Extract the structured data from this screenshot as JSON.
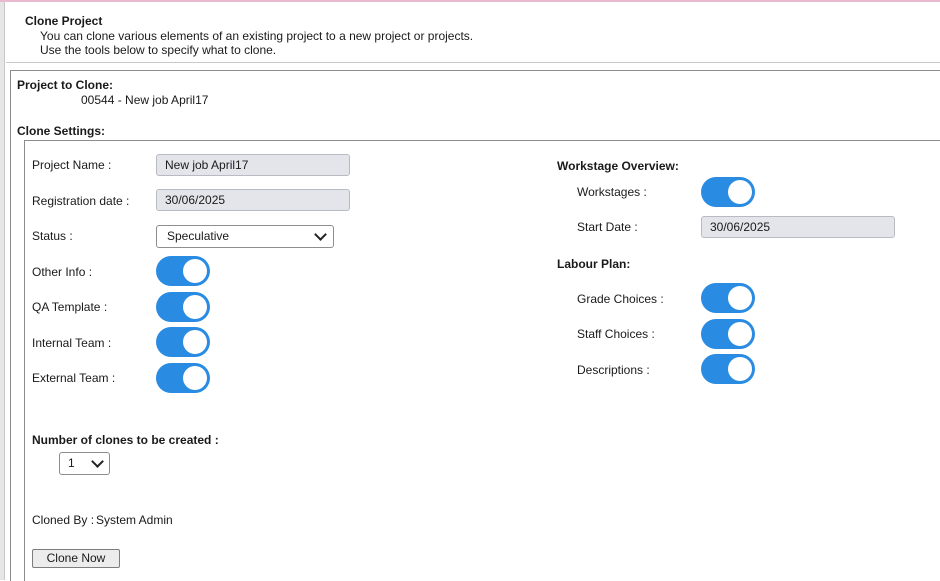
{
  "header": {
    "title": "Clone Project",
    "description_line1": "You can clone various elements of an existing project to a new project or projects.",
    "description_line2": "Use the tools below to specify what to clone."
  },
  "project_to_clone": {
    "label": "Project to Clone:",
    "value": "00544 - New job April17"
  },
  "clone_settings": {
    "label": "Clone Settings:",
    "project_name": {
      "label": "Project Name :",
      "value": "New job April17"
    },
    "registration_date": {
      "label": "Registration date :",
      "value": "30/06/2025"
    },
    "status": {
      "label": "Status :",
      "value": "Speculative"
    },
    "other_info": {
      "label": "Other Info :",
      "on": true
    },
    "qa_template": {
      "label": "QA Template :",
      "on": true
    },
    "internal_team": {
      "label": "Internal Team :",
      "on": true
    },
    "external_team": {
      "label": "External Team :",
      "on": true
    }
  },
  "workstage_overview": {
    "label": "Workstage Overview:",
    "workstages": {
      "label": "Workstages :",
      "on": true
    },
    "start_date": {
      "label": "Start Date :",
      "value": "30/06/2025"
    }
  },
  "labour_plan": {
    "label": "Labour Plan:",
    "grade_choices": {
      "label": "Grade Choices :",
      "on": true
    },
    "staff_choices": {
      "label": "Staff Choices :",
      "on": true
    },
    "descriptions": {
      "label": "Descriptions :",
      "on": true
    }
  },
  "number_of_clones": {
    "label": "Number of clones to be created :",
    "value": "1"
  },
  "cloned_by": {
    "label": "Cloned By :",
    "value": "System Admin"
  },
  "actions": {
    "clone_now_label": "Clone Now"
  },
  "colors": {
    "toggle_on": "#2a8be3",
    "field_bg": "#e4e5ea"
  },
  "icons": {
    "dropdown": "chevron-down-icon"
  }
}
